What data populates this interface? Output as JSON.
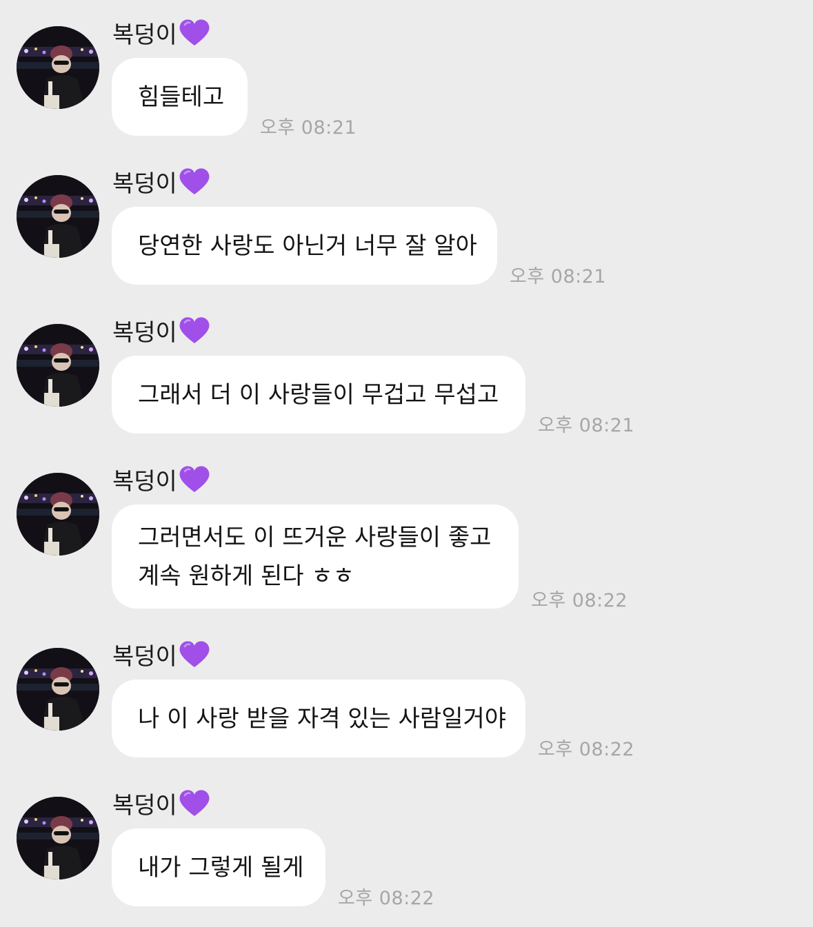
{
  "chat": {
    "sender_name": "복덩이",
    "heart_color": "#a04fe8",
    "messages": [
      {
        "lines": [
          "힘들테고"
        ],
        "time": "오후 08:21"
      },
      {
        "lines": [
          "당연한 사랑도 아닌거 너무 잘 알아"
        ],
        "time": "오후 08:21"
      },
      {
        "lines": [
          "그래서 더 이 사랑들이 무겁고 무섭고"
        ],
        "time": "오후 08:21"
      },
      {
        "lines": [
          "그러면서도 이 뜨거운 사랑들이 좋고",
          "계속 원하게 된다 ㅎㅎ"
        ],
        "time": "오후 08:22"
      },
      {
        "lines": [
          "나 이 사랑 받을 자격 있는 사람일거야"
        ],
        "time": "오후 08:22"
      },
      {
        "lines": [
          "내가 그렇게 될게"
        ],
        "time": "오후 08:22"
      }
    ]
  }
}
